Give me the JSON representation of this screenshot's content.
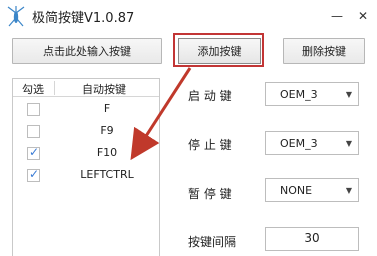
{
  "window": {
    "title": "极简按键V1.0.87",
    "min_glyph": "—",
    "close_glyph": "✕",
    "app_icon": "mosquito-icon"
  },
  "toolbar": {
    "input_button": "点击此处输入按键",
    "add_button": "添加按键",
    "delete_button": "删除按键"
  },
  "list": {
    "header_check": "勾选",
    "header_key": "自动按键",
    "rows": [
      {
        "key": "F",
        "checked": false
      },
      {
        "key": "F9",
        "checked": false
      },
      {
        "key": "F10",
        "checked": true
      },
      {
        "key": "LEFTCTRL",
        "checked": true
      }
    ]
  },
  "settings": {
    "start_label": "启 动 键",
    "start_value": "OEM_3",
    "stop_label": "停 止 键",
    "stop_value": "OEM_3",
    "pause_label": "暂 停 键",
    "pause_value": "NONE",
    "interval_label": "按键间隔",
    "interval_value": "30"
  },
  "colors": {
    "highlight": "#c23535",
    "arrow": "#c0392b",
    "check": "#3a7bd5"
  }
}
